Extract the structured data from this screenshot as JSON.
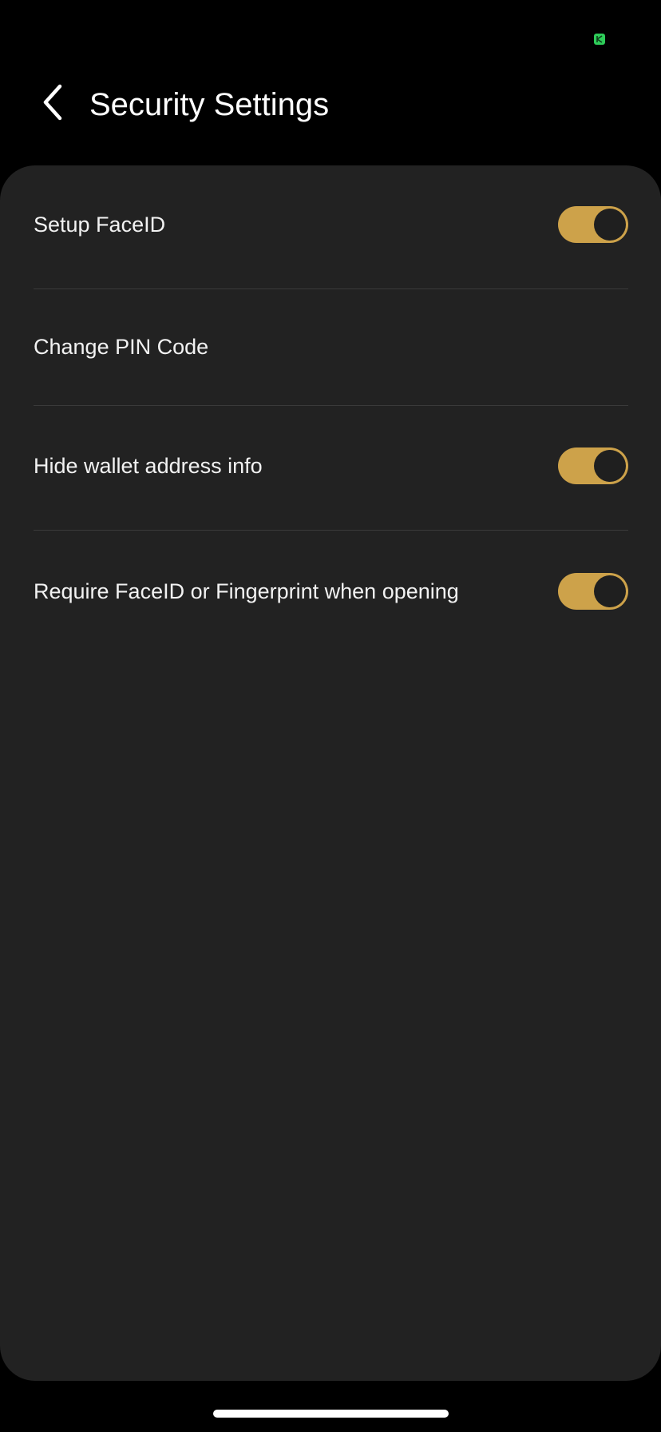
{
  "status_bar": {
    "indicator_icon": "privacy-indicator-icon",
    "indicator_color": "#2ecc59"
  },
  "header": {
    "back_icon": "chevron-left-icon",
    "title": "Security Settings"
  },
  "settings": [
    {
      "label": "Setup FaceID",
      "has_toggle": true,
      "toggle_on": true
    },
    {
      "label": "Change PIN Code",
      "has_toggle": false
    },
    {
      "label": "Hide wallet address info",
      "has_toggle": true,
      "toggle_on": true
    },
    {
      "label": "Require FaceID or Fingerprint when opening",
      "has_toggle": true,
      "toggle_on": true
    }
  ],
  "colors": {
    "background": "#000000",
    "card": "#222222",
    "accent": "#cda24a",
    "text": "#f2f2f2",
    "divider": "#3a3a3a"
  }
}
